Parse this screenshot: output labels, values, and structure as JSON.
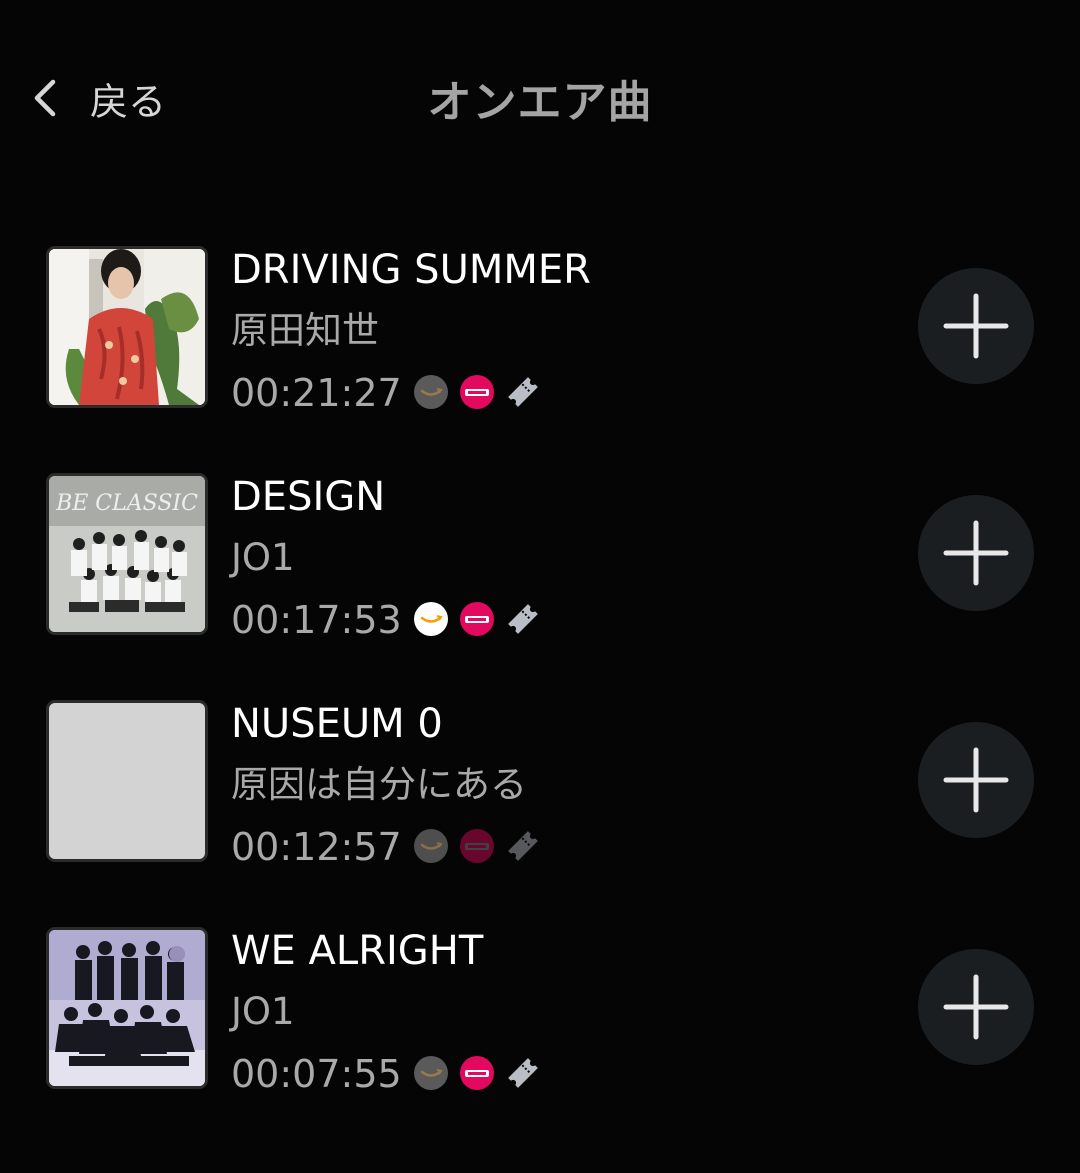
{
  "header": {
    "back_label": "戻る",
    "title": "オンエア曲"
  },
  "icons": {
    "back": "chevron-left-icon",
    "add": "plus-icon",
    "amazon": "amazon-music-icon",
    "recochoku": "recochoku-icon",
    "ticket": "ticket-icon"
  },
  "colors": {
    "background": "#050505",
    "add_button": "#1b1e21",
    "recochoku": "#e3095f",
    "amazon_smile": "#ff9900"
  },
  "tracks": [
    {
      "title": "DRIVING SUMMER",
      "artist": "原田知世",
      "time": "00:21:27",
      "cover": "photo",
      "amazon_active": false,
      "recochoku_active": true,
      "ticket_active": true
    },
    {
      "title": "DESIGN",
      "artist": "JO1",
      "time": "00:17:53",
      "cover": "photo",
      "cover_text": "BE CLASSIC",
      "amazon_active": true,
      "recochoku_active": true,
      "ticket_active": true
    },
    {
      "title": "NUSEUM 0",
      "artist": "原因は自分にある",
      "time": "00:12:57",
      "cover": "blank",
      "amazon_active": false,
      "recochoku_active": false,
      "ticket_active": false
    },
    {
      "title": "WE ALRIGHT",
      "artist": "JO1",
      "time": "00:07:55",
      "cover": "photo",
      "amazon_active": false,
      "recochoku_active": true,
      "ticket_active": true
    }
  ]
}
